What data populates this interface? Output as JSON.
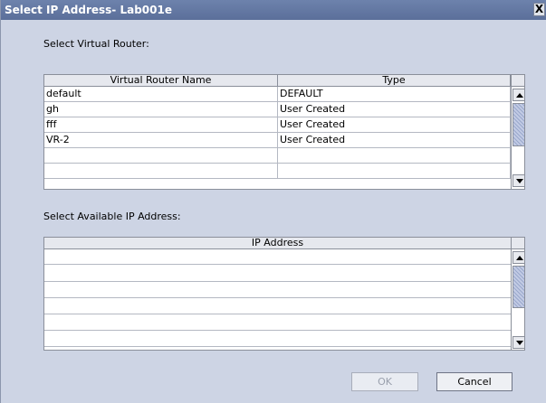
{
  "window": {
    "title": "Select IP Address- Lab001e",
    "close_label": "X"
  },
  "virtual_router": {
    "section_label": "Select Virtual Router:",
    "columns": [
      "Virtual Router Name",
      "Type"
    ],
    "rows": [
      [
        "default",
        "DEFAULT"
      ],
      [
        "gh",
        "User Created"
      ],
      [
        "fff",
        "User Created"
      ],
      [
        "VR-2",
        "User Created"
      ],
      [
        "",
        ""
      ],
      [
        "",
        ""
      ]
    ]
  },
  "ip_address": {
    "section_label": "Select Available IP Address:",
    "columns": [
      "IP Address"
    ],
    "rows": [
      [
        ""
      ],
      [
        ""
      ],
      [
        ""
      ],
      [
        ""
      ],
      [
        ""
      ],
      [
        ""
      ]
    ]
  },
  "buttons": {
    "ok_label": "OK",
    "cancel_label": "Cancel"
  },
  "icons": {
    "scroll_up": "arrow-up-icon",
    "scroll_down": "arrow-down-icon",
    "close": "close-icon"
  }
}
